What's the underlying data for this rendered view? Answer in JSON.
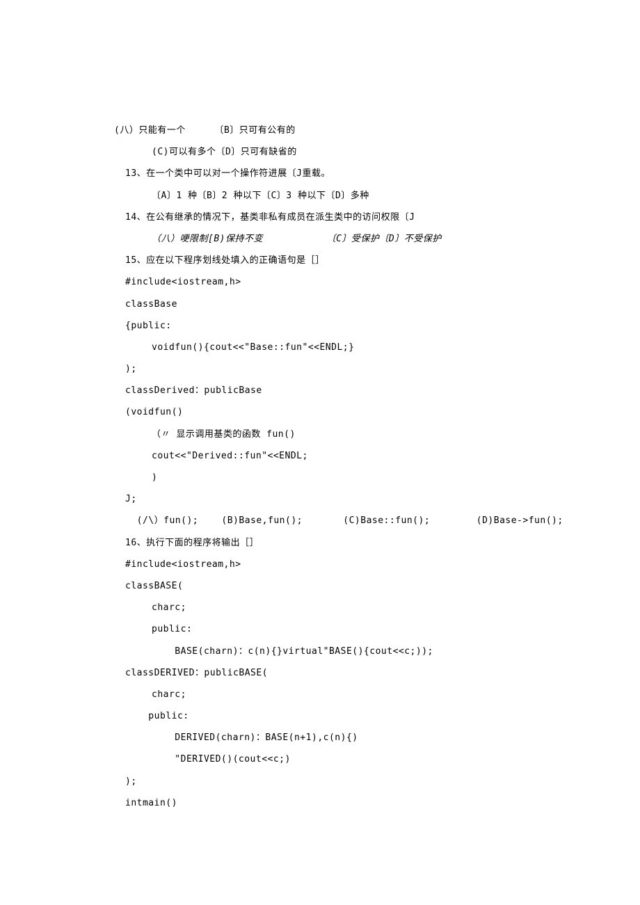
{
  "lines": [
    {
      "cls": "line l1",
      "text": "(八）只能有一个     〔B〕只可有公有的"
    },
    {
      "cls": "line indent1",
      "text": "(C)可以有多个〔D〕只可有缺省的"
    },
    {
      "cls": "line",
      "text": "13、在一个类中可以对一个操作符进展〔J重载。"
    },
    {
      "cls": "line indent1",
      "text": "〔A〕1 种〔B〕2 种以下〔C〕3 种以下〔D〕多种"
    },
    {
      "cls": "line",
      "text": "14、在公有继承的情况下，基类非私有成员在派生类中的访问权限〔J"
    },
    {
      "cls": "line indent1 italic",
      "text": "（八）哽限制[B)保持不变           〔C〕受保护〔D〕不受保护"
    },
    {
      "cls": "line",
      "text": "15、应在以下程序划线处填入的正确语句是［］"
    },
    {
      "cls": "line",
      "text": "#include<iostream,h>"
    },
    {
      "cls": "line",
      "text": "classBase"
    },
    {
      "cls": "line",
      "text": "{public:"
    },
    {
      "cls": "line indent1",
      "text": "voidfun(){cout<<\"Base::fun\"<<ENDL;}"
    },
    {
      "cls": "line",
      "text": ");"
    },
    {
      "cls": "line",
      "text": "classDerived：publicBase"
    },
    {
      "cls": "line",
      "text": "(voidfun()"
    },
    {
      "cls": "line indent1",
      "text": "（〃 显示调用基类的函数 fun()"
    },
    {
      "cls": "line indent1",
      "text": "cout<<\"Derived::fun\"<<ENDL;"
    },
    {
      "cls": "line indent1",
      "text": ")"
    },
    {
      "cls": "line",
      "text": "J;"
    },
    {
      "cls": "line",
      "text": "  (/\\）fun();    (B)Base,fun();       (C)Base::fun();        (D)Base->fun();"
    },
    {
      "cls": "line",
      "text": "16、执行下面的程序将输出［］"
    },
    {
      "cls": "line",
      "text": "#include<iostream,h>"
    },
    {
      "cls": "line",
      "text": "classBASE("
    },
    {
      "cls": "line indent1",
      "text": "charc;"
    },
    {
      "cls": "line indent1",
      "text": "public:"
    },
    {
      "cls": "line indent1",
      "text": "    BASE(charn)：c(n){}virtual\"BASE(){cout<<c;));"
    },
    {
      "cls": "line",
      "text": "classDERIVED：publicBASE("
    },
    {
      "cls": "line indent1",
      "text": "charc;"
    },
    {
      "cls": "line",
      "text": "    public:"
    },
    {
      "cls": "line indent1",
      "text": "    DERIVED(charn)：BASE(n+1),c(n){)"
    },
    {
      "cls": "line indent1",
      "text": "    \"DERIVED()(cout<<c;)"
    },
    {
      "cls": "line",
      "text": ");"
    },
    {
      "cls": "line",
      "text": "intmain()"
    }
  ]
}
